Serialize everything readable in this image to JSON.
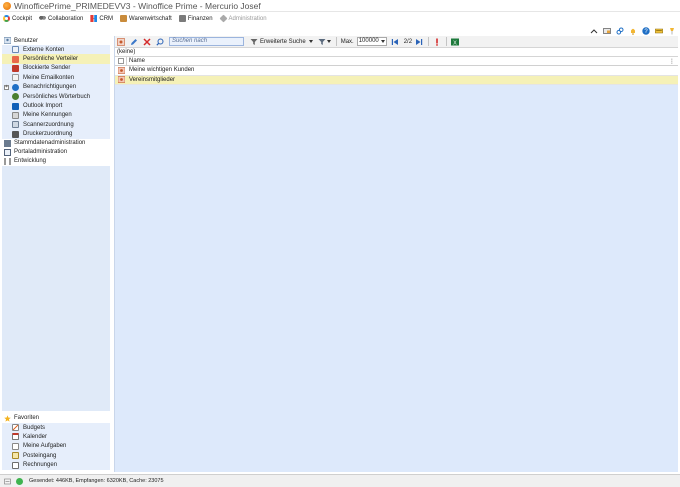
{
  "window": {
    "title": "WinofficePrime_PRIMEDEVV3 - Winoffice Prime - Mercurio Josef"
  },
  "menubar": {
    "items": [
      {
        "label": "Cockpit",
        "icon": "cockpit-icon",
        "enabled": true
      },
      {
        "label": "Collaboration",
        "icon": "collaboration-icon",
        "enabled": true
      },
      {
        "label": "CRM",
        "icon": "crm-icon",
        "enabled": true
      },
      {
        "label": "Warenwirtschaft",
        "icon": "warenwirtschaft-icon",
        "enabled": true
      },
      {
        "label": "Finanzen",
        "icon": "finanzen-icon",
        "enabled": true
      },
      {
        "label": "Administration",
        "icon": "administration-icon",
        "enabled": false
      }
    ]
  },
  "sidebar": {
    "benutzer": {
      "label": "Benutzer",
      "items": [
        {
          "label": "Externe Konten",
          "selected": false
        },
        {
          "label": "Persönliche Verteiler",
          "selected": true
        },
        {
          "label": "Blockierte Sender",
          "selected": false
        },
        {
          "label": "Meine Emailkonten",
          "selected": false
        },
        {
          "label": "Benachrichtigungen",
          "selected": false
        },
        {
          "label": "Persönliches Wörterbuch",
          "selected": false
        },
        {
          "label": "Outlook Import",
          "selected": false
        },
        {
          "label": "Meine Kennungen",
          "selected": false
        },
        {
          "label": "Scannerzuordnung",
          "selected": false
        },
        {
          "label": "Druckerzuordnung",
          "selected": false
        }
      ]
    },
    "groups": [
      {
        "label": "Stammdatenadministration"
      },
      {
        "label": "Portaladministration"
      },
      {
        "label": "Entwicklung"
      }
    ],
    "favoriten": {
      "label": "Favoriten",
      "items": [
        {
          "label": "Budgets"
        },
        {
          "label": "Kalender"
        },
        {
          "label": "Meine Aufgaben"
        },
        {
          "label": "Posteingang"
        },
        {
          "label": "Rechnungen"
        }
      ]
    }
  },
  "toolbar": {
    "search_placeholder": "Suchen nach",
    "advanced_search_label": "Erweiterte Suche",
    "max_label": "Max.",
    "max_value": "100000",
    "page_indicator": "2/2"
  },
  "grid": {
    "filter_text": "(keine)",
    "column_name": "Name",
    "rows": [
      {
        "name": "Meine wichtigen Kunden",
        "selected": false
      },
      {
        "name": "Vereinsmitglieder",
        "selected": true
      }
    ]
  },
  "statusbar": {
    "text": "Gesendet: 446KB, Empfangen: 6320KB, Cache: 23075"
  },
  "colors": {
    "selection": "#f5f1b7",
    "panel_blue": "#dde9fb",
    "status_green": "#3fb34f"
  }
}
